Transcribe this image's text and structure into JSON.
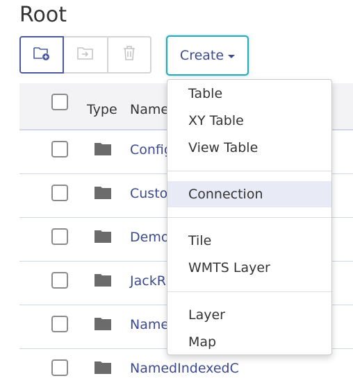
{
  "page": {
    "title": "Root"
  },
  "toolbar": {
    "create_label": "Create",
    "icons": [
      "new-folder-icon",
      "move-icon",
      "delete-icon"
    ]
  },
  "table": {
    "headers": {
      "type": "Type",
      "name": "Name"
    },
    "rows": [
      {
        "name": "Config",
        "icon": "folder-icon"
      },
      {
        "name": "Custo",
        "icon": "folder-icon"
      },
      {
        "name": "Demo",
        "icon": "folder-icon"
      },
      {
        "name": "JackR",
        "icon": "folder-icon"
      },
      {
        "name": "Name",
        "icon": "folder-icon"
      },
      {
        "name": "NamedIndexedC",
        "icon": "folder-icon"
      }
    ]
  },
  "create_menu": {
    "groups": [
      [
        "Table",
        "XY Table",
        "View Table"
      ],
      [
        "Connection"
      ],
      [
        "Tile",
        "WMTS Layer"
      ],
      [
        "Layer",
        "Map"
      ]
    ],
    "highlighted": "Connection"
  },
  "colors": {
    "accent": "#3b4a8e",
    "focus": "#2aa8b8",
    "highlight": "#e8eaf6"
  }
}
